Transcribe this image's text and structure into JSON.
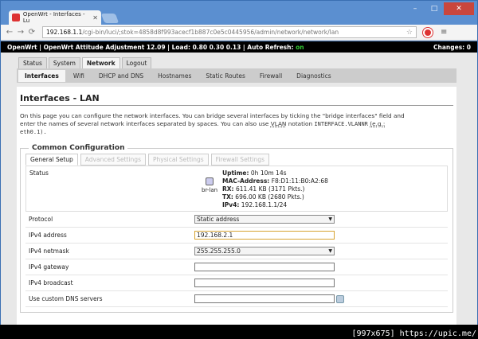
{
  "browser": {
    "tab_title": "OpenWrt - Interfaces - Lu",
    "url_host": "192.168.1.1",
    "url_path": "/cgi-bin/luci/;stok=4858d8f993acecf1b887c0e5c0445956/admin/network/network/lan"
  },
  "topbar": {
    "host": "OpenWrt",
    "version": "OpenWrt Attitude Adjustment 12.09",
    "load": "Load: 0.80 0.30 0.13",
    "autorefresh": "Auto Refresh:",
    "autorefresh_state": "on",
    "changes": "Changes: 0"
  },
  "main_tabs": [
    "Status",
    "System",
    "Network",
    "Logout"
  ],
  "sub_tabs": [
    "Interfaces",
    "Wifi",
    "DHCP and DNS",
    "Hostnames",
    "Static Routes",
    "Firewall",
    "Diagnostics"
  ],
  "page": {
    "title": "Interfaces - LAN",
    "desc1": "On this page you can configure the network interfaces. You can bridge several interfaces by ticking the \"bridge interfaces\" field and",
    "desc2_pre": "enter the names of several network interfaces separated by spaces. You can also use ",
    "desc2_vlan": "VLAN",
    "desc2_mid": " notation ",
    "desc2_code": "INTERFACE.VLANNR",
    "desc2_eg": "(e.g.:",
    "desc3": "eth0.1)."
  },
  "config": {
    "legend": "Common Configuration",
    "tabs": [
      "General Setup",
      "Advanced Settings",
      "Physical Settings",
      "Firewall Settings"
    ],
    "status_label": "Status",
    "iface_name": "br-lan",
    "uptime_k": "Uptime:",
    "uptime_v": "0h 10m 14s",
    "mac_k": "MAC-Address:",
    "mac_v": "F8:D1:11:B0:A2:68",
    "rx_k": "RX:",
    "rx_v": "611.41 KB (3171 Pkts.)",
    "tx_k": "TX:",
    "tx_v": "696.00 KB (2680 Pkts.)",
    "ipv4_k": "IPv4:",
    "ipv4_v": "192.168.1.1/24"
  },
  "fields": {
    "protocol_label": "Protocol",
    "protocol_value": "Static address",
    "ipv4addr_label": "IPv4 address",
    "ipv4addr_value": "192.168.2.1",
    "netmask_label": "IPv4 netmask",
    "netmask_value": "255.255.255.0",
    "gateway_label": "IPv4 gateway",
    "broadcast_label": "IPv4 broadcast",
    "dns_label": "Use custom DNS servers"
  },
  "watermark": "[997x675] https://upic.me/"
}
